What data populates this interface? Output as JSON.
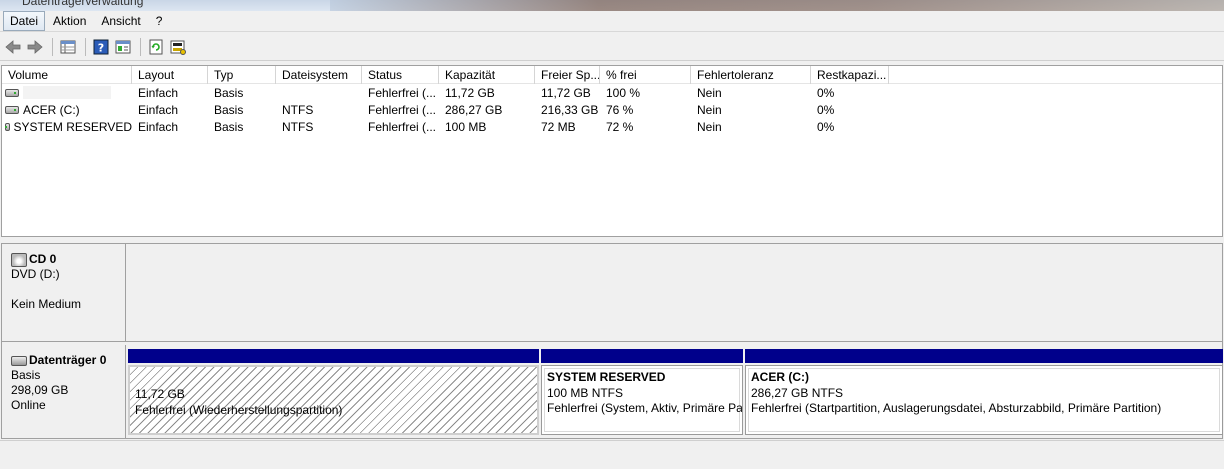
{
  "window": {
    "title": "Datenträgerverwaltung"
  },
  "menubar": {
    "items": [
      "Datei",
      "Aktion",
      "Ansicht",
      "?"
    ]
  },
  "toolbar": {
    "buttons": [
      "back-icon",
      "forward-icon",
      "list-view-icon",
      "help-icon",
      "properties-icon",
      "refresh-icon",
      "rescan-icon"
    ]
  },
  "volumes": {
    "columns": [
      "Volume",
      "Layout",
      "Typ",
      "Dateisystem",
      "Status",
      "Kapazität",
      "Freier Sp...",
      "% frei",
      "Fehlertoleranz",
      "Restkapazi..."
    ],
    "rows": [
      [
        "",
        "Einfach",
        "Basis",
        "",
        "Fehlerfrei (...",
        "11,72 GB",
        "11,72 GB",
        "100 %",
        "Nein",
        "0%"
      ],
      [
        "ACER (C:)",
        "Einfach",
        "Basis",
        "NTFS",
        "Fehlerfrei (...",
        "286,27 GB",
        "216,33 GB",
        "76 %",
        "Nein",
        "0%"
      ],
      [
        "SYSTEM RESERVED",
        "Einfach",
        "Basis",
        "NTFS",
        "Fehlerfrei (...",
        "100 MB",
        "72 MB",
        "72 %",
        "Nein",
        "0%"
      ]
    ]
  },
  "cd0": {
    "name": "CD 0",
    "type": "DVD (D:)",
    "media": "Kein Medium"
  },
  "disk0": {
    "name": "Datenträger 0",
    "kind": "Basis",
    "size": "298,09 GB",
    "state": "Online",
    "partitions": [
      {
        "title": "",
        "size": "11,72 GB",
        "status": "Fehlerfrei (Wiederherstellungspartition)"
      },
      {
        "title": "SYSTEM RESERVED",
        "size": "100 MB NTFS",
        "status": "Fehlerfrei (System, Aktiv, Primäre Pa"
      },
      {
        "title": "ACER  (C:)",
        "size": "286,27 GB NTFS",
        "status": "Fehlerfrei (Startpartition, Auslagerungsdatei, Absturzabbild, Primäre Partition)"
      }
    ]
  },
  "colors": {
    "partition_bar": "#00008b",
    "pane_bg": "#f0f0f0"
  }
}
